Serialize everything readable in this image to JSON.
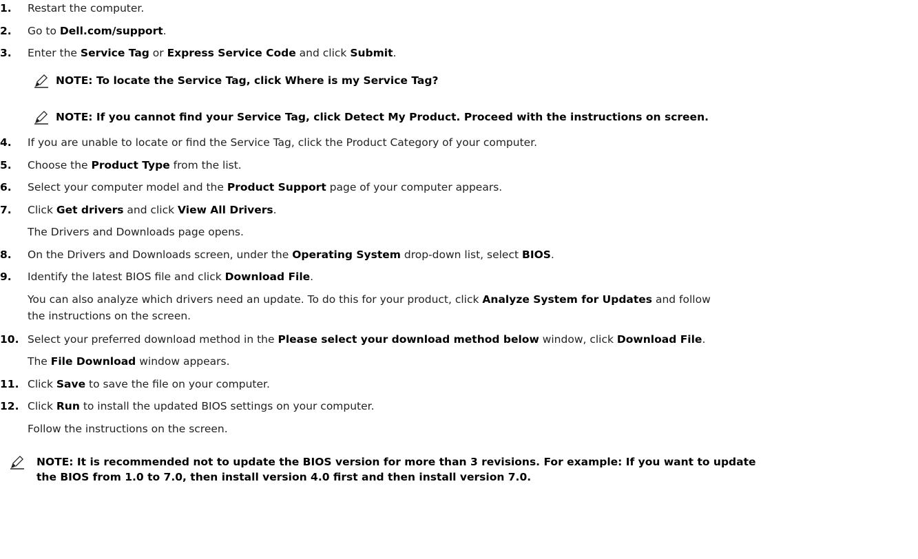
{
  "steps": [
    {
      "num": "1.",
      "parts": [
        {
          "t": "Restart the computer."
        }
      ]
    },
    {
      "num": "2.",
      "parts": [
        {
          "t": "Go to "
        },
        {
          "t": "Dell.com/support",
          "b": true
        },
        {
          "t": "."
        }
      ]
    },
    {
      "num": "3.",
      "parts": [
        {
          "t": "Enter the "
        },
        {
          "t": "Service Tag",
          "b": true
        },
        {
          "t": " or "
        },
        {
          "t": "Express Service Code",
          "b": true
        },
        {
          "t": " and click "
        },
        {
          "t": "Submit",
          "b": true
        },
        {
          "t": "."
        }
      ]
    },
    {
      "num": "4.",
      "parts": [
        {
          "t": "If you are unable to locate or find the Service Tag, click the Product Category of your computer."
        }
      ]
    },
    {
      "num": "5.",
      "parts": [
        {
          "t": "Choose the "
        },
        {
          "t": "Product Type",
          "b": true
        },
        {
          "t": " from the list."
        }
      ]
    },
    {
      "num": "6.",
      "parts": [
        {
          "t": "Select your computer model and the "
        },
        {
          "t": "Product Support",
          "b": true
        },
        {
          "t": " page of your computer appears."
        }
      ]
    },
    {
      "num": "7.",
      "parts": [
        {
          "t": "Click "
        },
        {
          "t": "Get drivers",
          "b": true
        },
        {
          "t": " and click "
        },
        {
          "t": "View All Drivers",
          "b": true
        },
        {
          "t": "."
        }
      ]
    },
    {
      "num": "8.",
      "parts": [
        {
          "t": "On the Drivers and Downloads screen, under the "
        },
        {
          "t": "Operating System",
          "b": true
        },
        {
          "t": " drop-down list, select "
        },
        {
          "t": "BIOS",
          "b": true
        },
        {
          "t": "."
        }
      ]
    },
    {
      "num": "9.",
      "parts": [
        {
          "t": "Identify the latest BIOS file and click "
        },
        {
          "t": "Download File",
          "b": true
        },
        {
          "t": "."
        }
      ]
    },
    {
      "num": "10.",
      "parts": [
        {
          "t": "Select your preferred download method in the "
        },
        {
          "t": "Please select your download method below",
          "b": true
        },
        {
          "t": " window, click "
        },
        {
          "t": "Download File",
          "b": true
        },
        {
          "t": "."
        }
      ]
    },
    {
      "num": "11.",
      "parts": [
        {
          "t": "Click "
        },
        {
          "t": "Save",
          "b": true
        },
        {
          "t": " to save the file on your computer."
        }
      ]
    },
    {
      "num": "12.",
      "parts": [
        {
          "t": "Click "
        },
        {
          "t": "Run",
          "b": true
        },
        {
          "t": " to install the updated BIOS settings on your computer."
        }
      ]
    }
  ],
  "subs": {
    "s7": [
      {
        "t": "The Drivers and Downloads page opens."
      }
    ],
    "s9a": [
      {
        "t": "You can also analyze which drivers need an update. To do this for your product, click "
      },
      {
        "t": "Analyze System for Updates",
        "b": true
      },
      {
        "t": " and follow"
      }
    ],
    "s9b": [
      {
        "t": "the instructions on the screen."
      }
    ],
    "s10": [
      {
        "t": "The "
      },
      {
        "t": "File Download",
        "b": true
      },
      {
        "t": " window appears."
      }
    ],
    "s12": [
      {
        "t": "Follow the instructions on the screen."
      }
    ]
  },
  "notes": {
    "n1": "NOTE: To locate the Service Tag, click Where is my Service Tag?",
    "n2": "NOTE: If you cannot find your Service Tag, click Detect My Product. Proceed with the instructions on screen.",
    "n3a": "NOTE: It is recommended not to update the BIOS version for more than 3 revisions. For example: If you want to update",
    "n3b": "the BIOS from 1.0 to 7.0, then install version 4.0 first and then install version 7.0."
  },
  "icons": {
    "note": "pencil-note-icon"
  }
}
